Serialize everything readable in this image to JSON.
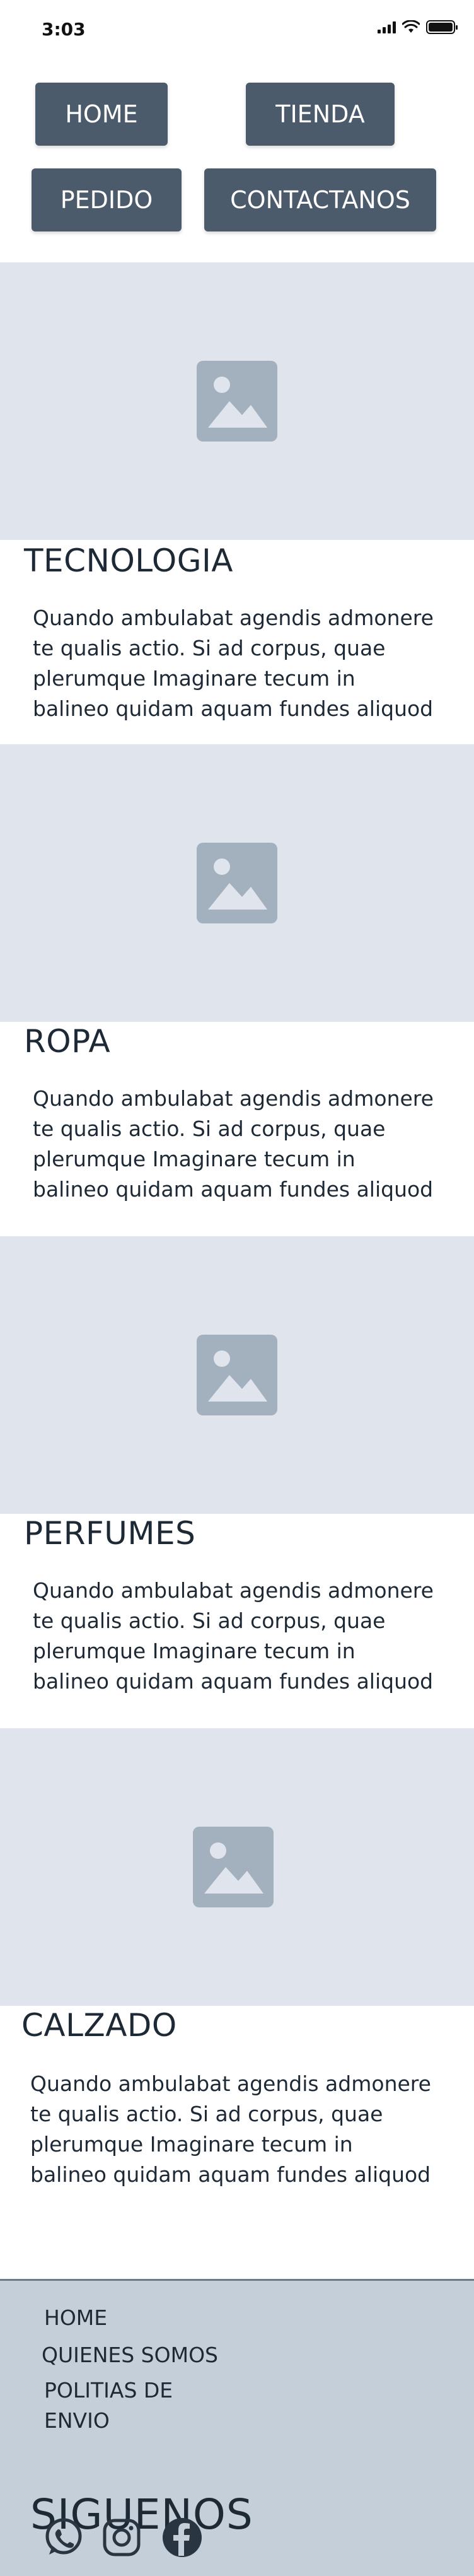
{
  "status_bar": {
    "time": "3:03",
    "icons": [
      "signal-icon",
      "wifi-icon",
      "battery-icon"
    ]
  },
  "nav": {
    "home": "HOME",
    "tienda": "TIENDA",
    "pedido": "PEDIDO",
    "contactanos": "CONTACTANOS"
  },
  "sections": [
    {
      "title": "TECNOLOGIA",
      "text": "Quando ambulabat agendis admonere te qualis actio. Si ad corpus, quae plerumque Imaginare tecum in balineo quidam aquam fundes aliquod",
      "image_icon": "image-placeholder-icon"
    },
    {
      "title": "ROPA",
      "text": "Quando ambulabat agendis admonere te qualis actio. Si ad corpus, quae plerumque Imaginare tecum in balineo quidam aquam fundes aliquod",
      "image_icon": "image-placeholder-icon"
    },
    {
      "title": "PERFUMES",
      "text": "Quando ambulabat agendis admonere te qualis actio. Si ad corpus, quae plerumque Imaginare tecum in balineo quidam aquam fundes aliquod",
      "image_icon": "image-placeholder-icon"
    },
    {
      "title": "CALZADO",
      "text": "Quando ambulabat agendis admonere te qualis actio. Si ad corpus, quae plerumque Imaginare tecum in balineo quidam aquam fundes aliquod",
      "image_icon": "image-placeholder-icon"
    }
  ],
  "footer": {
    "links": [
      "HOME",
      "QUIENES SOMOS",
      "POLITIAS DE\nENVIO"
    ],
    "follow": "SIGUENOS",
    "social": [
      "whatsapp-icon",
      "instagram-icon",
      "facebook-icon"
    ]
  },
  "colors": {
    "nav_button": "#4b5b6c",
    "image_placeholder": "#e0e5ed",
    "placeholder_icon": "#a3b1bf",
    "footer_bg": "#c4cfd9",
    "text": "#1e2936"
  }
}
